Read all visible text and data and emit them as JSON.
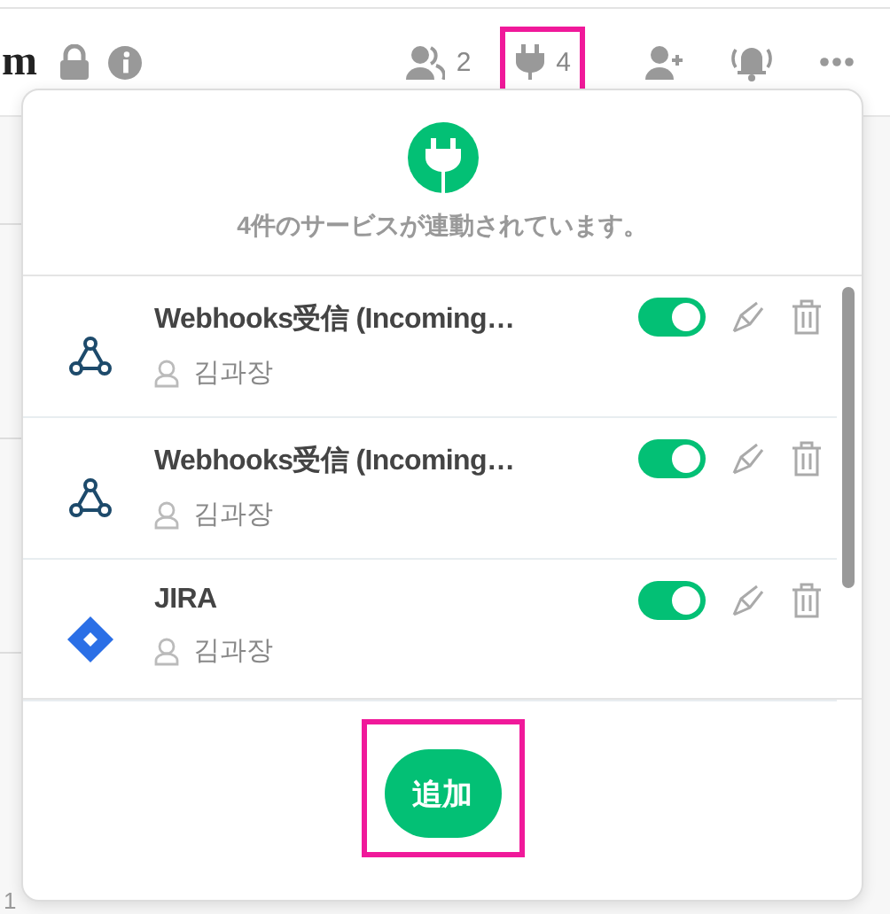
{
  "header": {
    "title": "m",
    "members_count": "2",
    "integrations_count": "4"
  },
  "page_number": "1",
  "integrations": {
    "summary": "4件のサービスが連動されています。",
    "items": [
      {
        "kind": "webhook",
        "name": "Webhooks受信 (Incoming…",
        "owner": "김과장",
        "on": true
      },
      {
        "kind": "webhook",
        "name": "Webhooks受信 (Incoming…",
        "owner": "김과장",
        "on": true
      },
      {
        "kind": "jira",
        "name": "JIRA",
        "owner": "김과장",
        "on": true
      }
    ],
    "add_button": "追加"
  }
}
